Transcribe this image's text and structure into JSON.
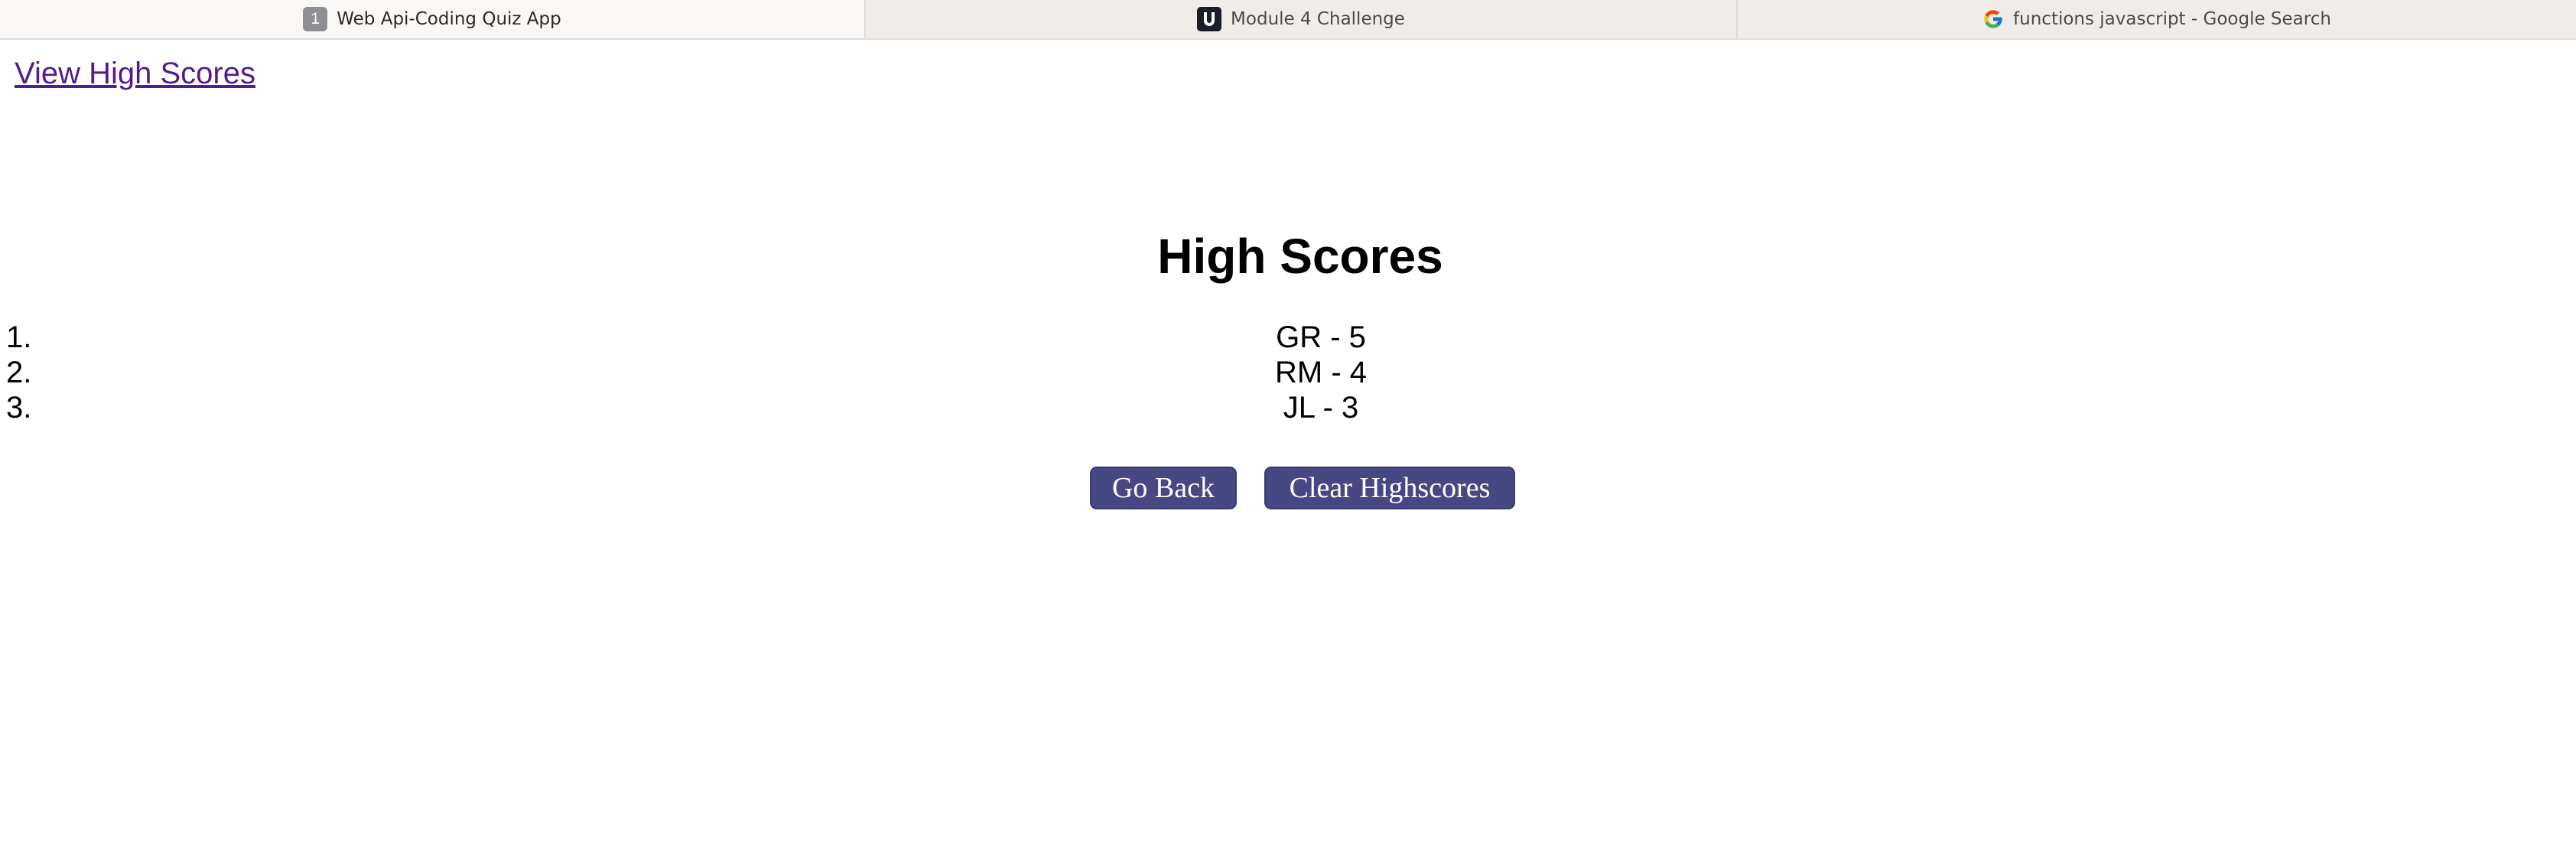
{
  "tabs": [
    {
      "label": "Web Api-Coding Quiz App",
      "icon": "number-badge-icon",
      "badge": "1",
      "active": true
    },
    {
      "label": "Module 4 Challenge",
      "icon": "u-logo-icon",
      "active": false
    },
    {
      "label": "functions javascript - Google Search",
      "icon": "google-g-icon",
      "active": false
    }
  ],
  "page": {
    "view_link": "View High Scores",
    "title": "High Scores",
    "scores": [
      {
        "num": "1.",
        "text": "GR - 5"
      },
      {
        "num": "2.",
        "text": "RM - 4"
      },
      {
        "num": "3.",
        "text": "JL - 3"
      }
    ],
    "buttons": {
      "back": "Go Back",
      "clear": "Clear Highscores"
    }
  },
  "colors": {
    "link": "#551a8b",
    "button": "#474784",
    "button_text": "#ffffff",
    "tabbar": "#efecea"
  }
}
